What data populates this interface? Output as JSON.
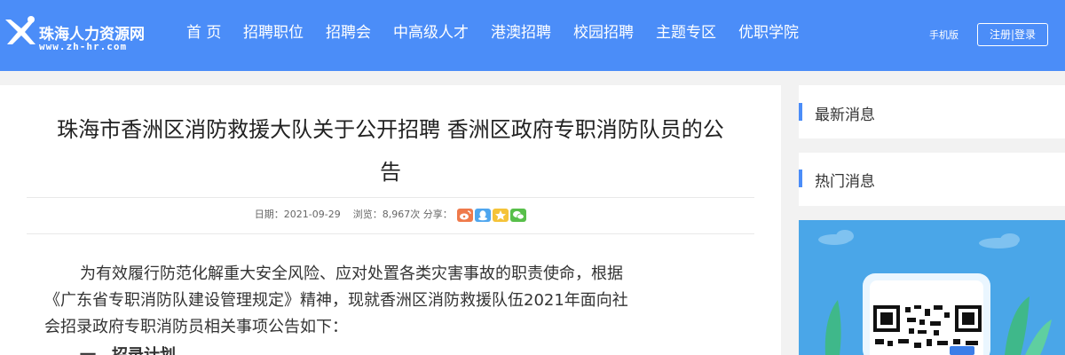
{
  "header": {
    "logo_text": "珠海人力资源网",
    "logo_url": "www.zh-hr.com",
    "nav": [
      "首 页",
      "招聘职位",
      "招聘会",
      "中高级人才",
      "港澳招聘",
      "校园招聘",
      "主题专区",
      "优职学院"
    ],
    "mobile_label": "手机版",
    "register_login": "注册|登录"
  },
  "article": {
    "title_line1": "珠海市香洲区消防救援大队关于公开招聘 香洲区政府专职消防队员的公",
    "title_line2": "告",
    "date_label": "日期：",
    "date": "2021-09-29",
    "views_label": "浏览：",
    "views": "8,967次",
    "share_label": "分享：",
    "paragraph": [
      "为有效履行防范化解重大安全风险、应对处置各类灾害事故的职责使命，根据",
      "《广东省专职消防队建设管理规定》精神，现就香洲区消防救援队伍2021年面向社",
      "会招录政府专职消防员相关事项公告如下："
    ],
    "heading1": "一、招录计划"
  },
  "sidebar": {
    "latest": "最新消息",
    "hot": "热门消息"
  },
  "colors": {
    "header_bg": "#4b8df8",
    "accent": "#4b8df8",
    "share_weibo": "#ef7a4b",
    "share_qq": "#4fa6ee",
    "share_qzone": "#f5c338",
    "share_wechat": "#58bf4a"
  }
}
